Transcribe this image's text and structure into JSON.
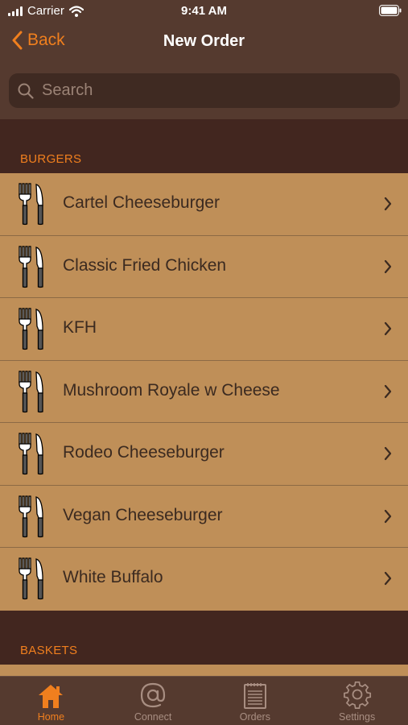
{
  "status_bar": {
    "carrier": "Carrier",
    "time": "9:41 AM"
  },
  "nav": {
    "back_label": "Back",
    "title": "New Order"
  },
  "search": {
    "placeholder": "Search"
  },
  "sections": [
    {
      "header": "BURGERS",
      "items": [
        "Cartel Cheeseburger",
        "Classic Fried Chicken",
        "KFH",
        "Mushroom Royale w Cheese",
        "Rodeo Cheeseburger",
        "Vegan Cheeseburger",
        "White Buffalo"
      ]
    },
    {
      "header": "BASKETS",
      "items": []
    }
  ],
  "tabs": [
    {
      "label": "Home",
      "icon": "home-icon",
      "active": true
    },
    {
      "label": "Connect",
      "icon": "at-icon",
      "active": false
    },
    {
      "label": "Orders",
      "icon": "notepad-icon",
      "active": false
    },
    {
      "label": "Settings",
      "icon": "gear-icon",
      "active": false
    }
  ],
  "colors": {
    "accent": "#f07f1e",
    "row_bg": "#bf8f58",
    "nav_bg": "#553a2f",
    "page_bg": "#42261f"
  }
}
